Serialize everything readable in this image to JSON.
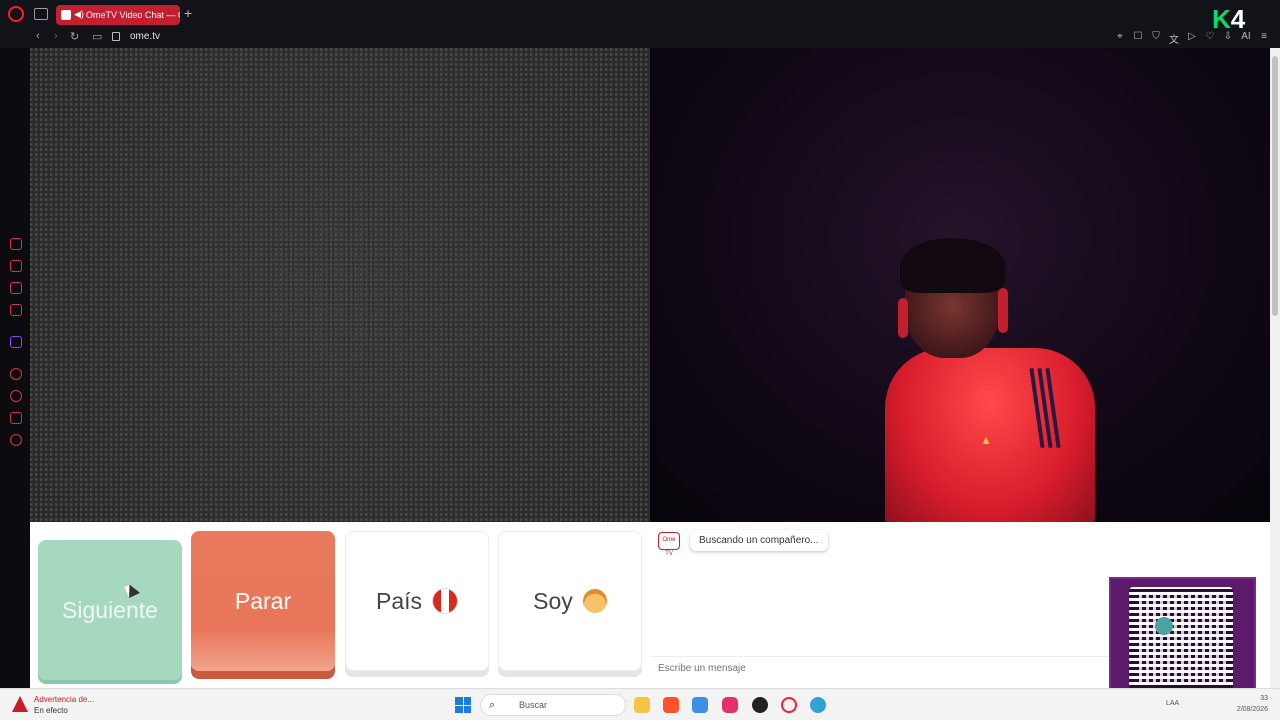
{
  "browser": {
    "tab_title": "OmeTV Video Chat — C",
    "url": "ome.tv"
  },
  "overlay": {
    "k": "K",
    "n": "4"
  },
  "controls": {
    "next_label": "Siguiente",
    "stop_label": "Parar",
    "country_label": "País",
    "soy_label": "Soy"
  },
  "chat": {
    "logo_text": "Ome TV",
    "status_message": "Buscando un compañero...",
    "input_placeholder": "Escribe un mensaje"
  },
  "taskbar": {
    "warning_title": "Advertencia de...",
    "warning_subtitle": "En efecto",
    "search_label": "Buscar",
    "lang": "LAA",
    "time": "33",
    "date": "2/08/2026"
  },
  "colors": {
    "accent": "#c21f2f",
    "next_button": "#a6d8c0",
    "stop_button": "#e8765a"
  }
}
